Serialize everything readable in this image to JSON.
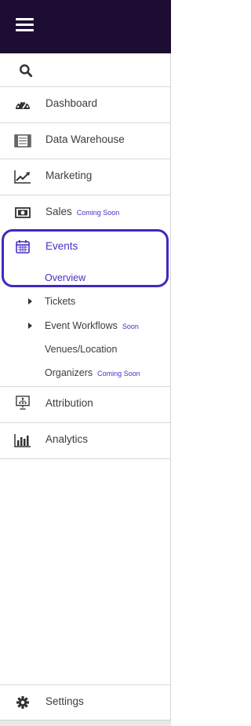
{
  "menu": {
    "dashboard": "Dashboard",
    "data_warehouse": "Data Warehouse",
    "marketing": "Marketing",
    "sales": "Sales",
    "sales_badge": "Coming Soon",
    "events": "Events",
    "attribution": "Attribution",
    "analytics": "Analytics",
    "settings": "Settings"
  },
  "events_sub": {
    "overview": "Overview",
    "tickets": "Tickets",
    "event_workflows": "Event Workflows",
    "event_workflows_badge": "Soon",
    "venues": "Venues/Location",
    "organizers": "Organizers",
    "organizers_badge": "Coming Soon"
  },
  "icons": {
    "menu": "hamburger-icon",
    "search": "search-icon",
    "dashboard": "gauge-icon",
    "data_warehouse": "warehouse-icon",
    "marketing": "trend-chart-icon",
    "sales": "cash-icon",
    "events": "calendar-icon",
    "attribution": "presentation-icon",
    "analytics": "bar-chart-icon",
    "settings": "gear-icon"
  },
  "colors": {
    "topbar": "#1e0d33",
    "accent": "#4a2ec6",
    "highlight_border": "#3b2bbd"
  }
}
